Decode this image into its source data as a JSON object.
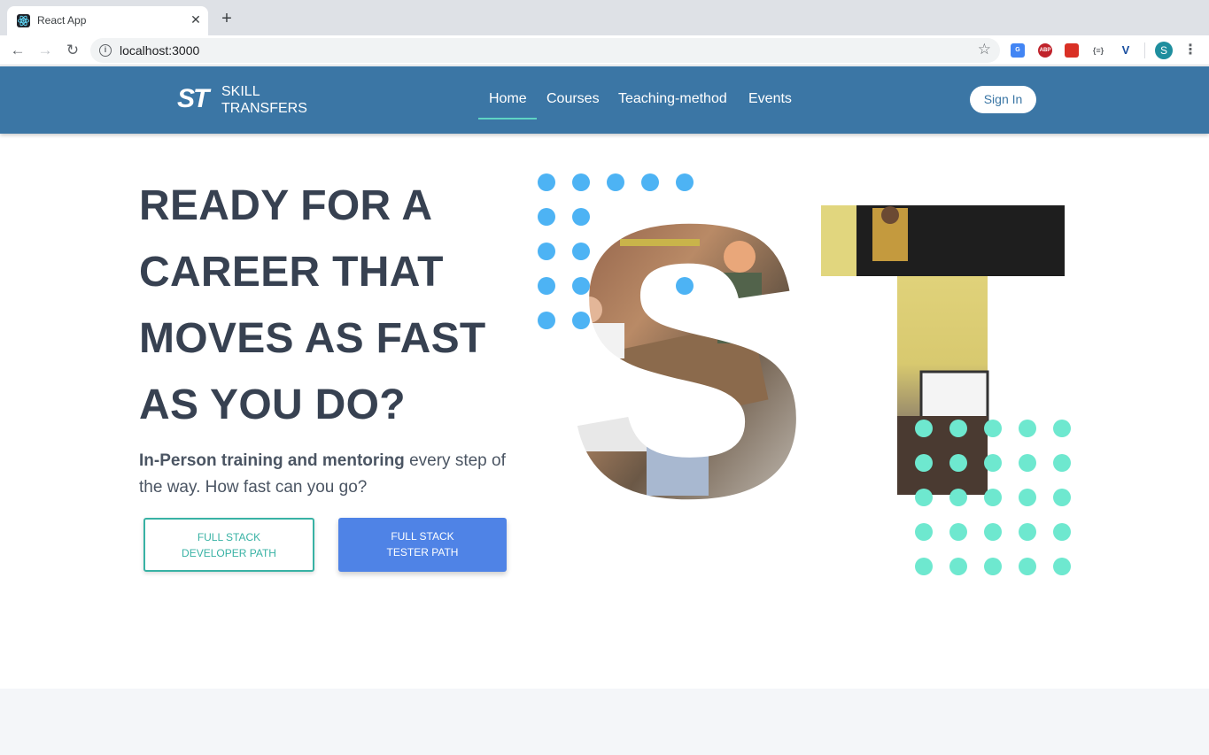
{
  "browser": {
    "tab_title": "React App",
    "url": "localhost:3000",
    "profile_initial": "S",
    "extensions": [
      "google-translate-icon",
      "adblock-plus-icon",
      "ext-red-icon",
      "json-formatter-icon",
      "vuejs-devtools-icon"
    ],
    "extension_labels": [
      "G",
      "ABP",
      "",
      "{≡}",
      "V"
    ]
  },
  "site": {
    "logo_mark": "ST",
    "logo_line1": "SKILL",
    "logo_line2": "TRANSFERS",
    "nav": [
      {
        "label": "Home",
        "active": true
      },
      {
        "label": "Courses",
        "active": false
      },
      {
        "label": "Teaching-method",
        "active": false
      },
      {
        "label": "Events",
        "active": false
      }
    ],
    "signin_label": "Sign In"
  },
  "hero": {
    "title_lines": [
      "READY FOR A",
      "CAREER THAT",
      "MOVES AS FAST",
      "AS YOU DO?"
    ],
    "subtitle_bold": "In-Person training and mentoring",
    "subtitle_rest": " every step of the way. How fast can you go?",
    "btn_developer": "FULL STACK DEVELOPER PATH",
    "btn_tester": "FULL STACK TESTER PATH",
    "art_letters": "ST"
  },
  "colors": {
    "header": "#3b76a5",
    "accent_teal": "#38b2a4",
    "button_blue": "#4f83e6",
    "dots_blue": "#4db3f4",
    "dots_mint": "#6ee8cf",
    "title": "#374151"
  }
}
